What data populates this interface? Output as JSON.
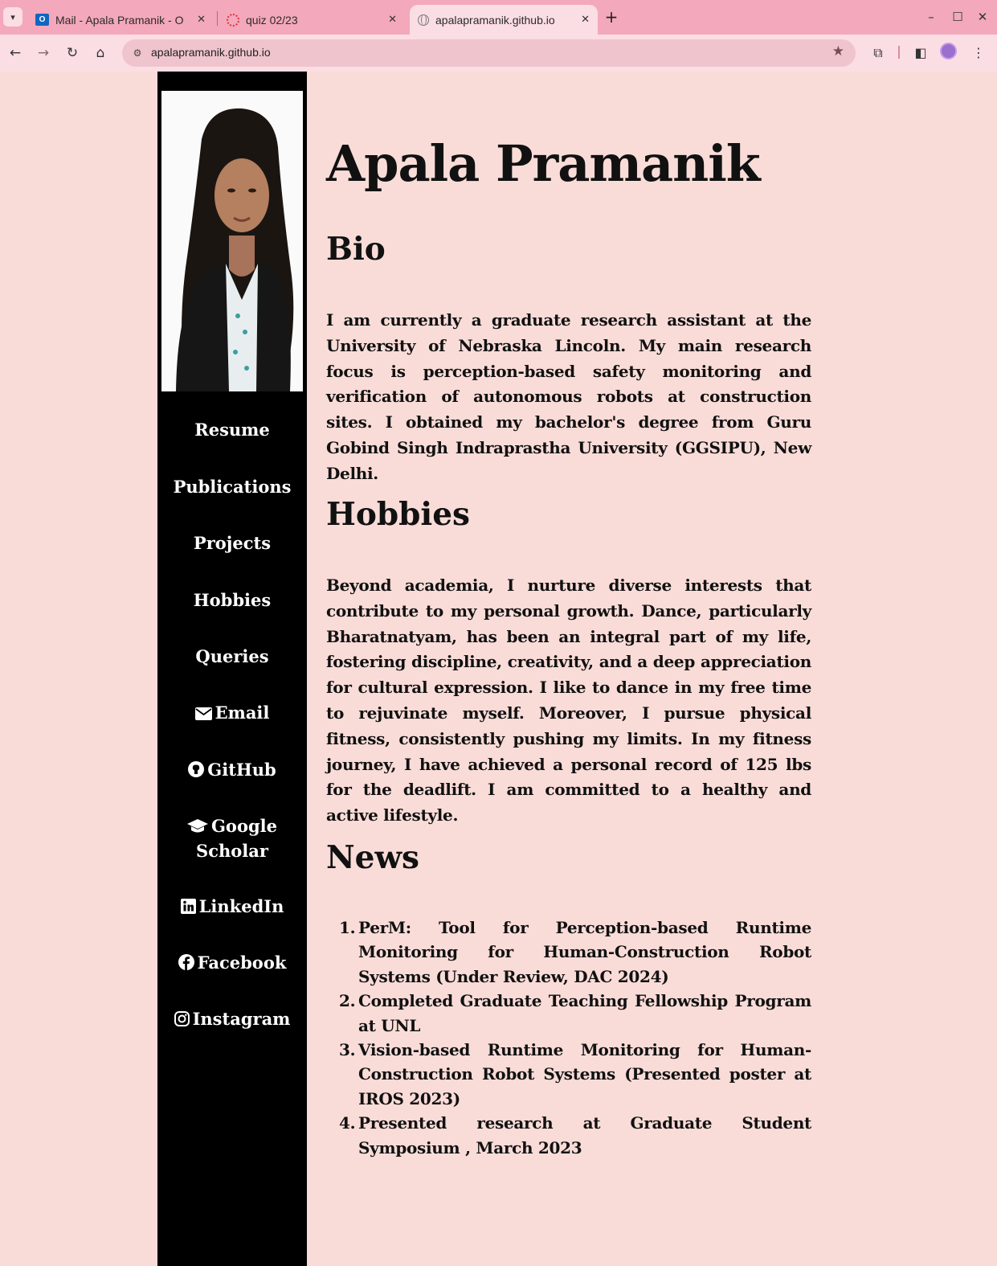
{
  "browser": {
    "tabs": [
      {
        "title": "Mail - Apala Pramanik - O",
        "icon": "outlook-icon"
      },
      {
        "title": "quiz 02/23",
        "icon": "quiz-icon"
      },
      {
        "title": "apalapramanik.github.io",
        "icon": "globe-icon"
      }
    ],
    "active_tab_index": 2,
    "url": "apalapramanik.github.io"
  },
  "sidebar": {
    "nav": [
      {
        "label": "Resume"
      },
      {
        "label": "Publications"
      },
      {
        "label": "Projects"
      },
      {
        "label": "Hobbies"
      },
      {
        "label": "Queries"
      },
      {
        "label": "Email",
        "icon": "envelope-icon"
      },
      {
        "label": "GitHub",
        "icon": "github-icon"
      },
      {
        "label": "Google",
        "label2": "Scholar",
        "icon": "graduation-cap-icon"
      },
      {
        "label": "LinkedIn",
        "icon": "linkedin-icon"
      },
      {
        "label": "Facebook",
        "icon": "facebook-icon"
      },
      {
        "label": "Instagram",
        "icon": "instagram-icon"
      }
    ]
  },
  "main": {
    "title": "Apala Pramanik",
    "bio": {
      "heading": "Bio",
      "text": "I am currently a graduate research assistant at the University of Nebraska Lincoln. My main research focus is perception-based safety monitoring and verification of autonomous robots at construction sites. I obtained my bachelor's degree from Guru Gobind Singh Indraprastha University (GGSIPU), New Delhi."
    },
    "hobbies": {
      "heading": "Hobbies",
      "text": "Beyond academia, I nurture diverse interests that contribute to my personal growth. Dance, particularly Bharatnatyam, has been an integral part of my life, fostering discipline, creativity, and a deep appreciation for cultural expression. I like to dance in my free time to rejuvinate myself. Moreover, I pursue physical fitness, consistently pushing my limits. In my fitness journey, I have achieved a personal record of 125 lbs for the deadlift. I am committed to a healthy and active lifestyle."
    },
    "news": {
      "heading": "News",
      "items": [
        {
          "num": "1.",
          "text": "PerM: Tool for Perception-based Runtime Monitoring for Human-Construction Robot Systems (Under Review, DAC 2024)"
        },
        {
          "num": "2.",
          "text": "Completed Graduate Teaching Fellowship Program at UNL"
        },
        {
          "num": "3.",
          "text": "Vision-based Runtime Monitoring for Human-Construction Robot Systems (Presented poster at IROS 2023)"
        },
        {
          "num": "4.",
          "text": "Presented research at Graduate Student Symposium , March 2023"
        }
      ]
    }
  },
  "colors": {
    "page_background": "#f9dcd8",
    "sidebar_background": "#000000",
    "tab_strip": "#f3a8bb"
  }
}
